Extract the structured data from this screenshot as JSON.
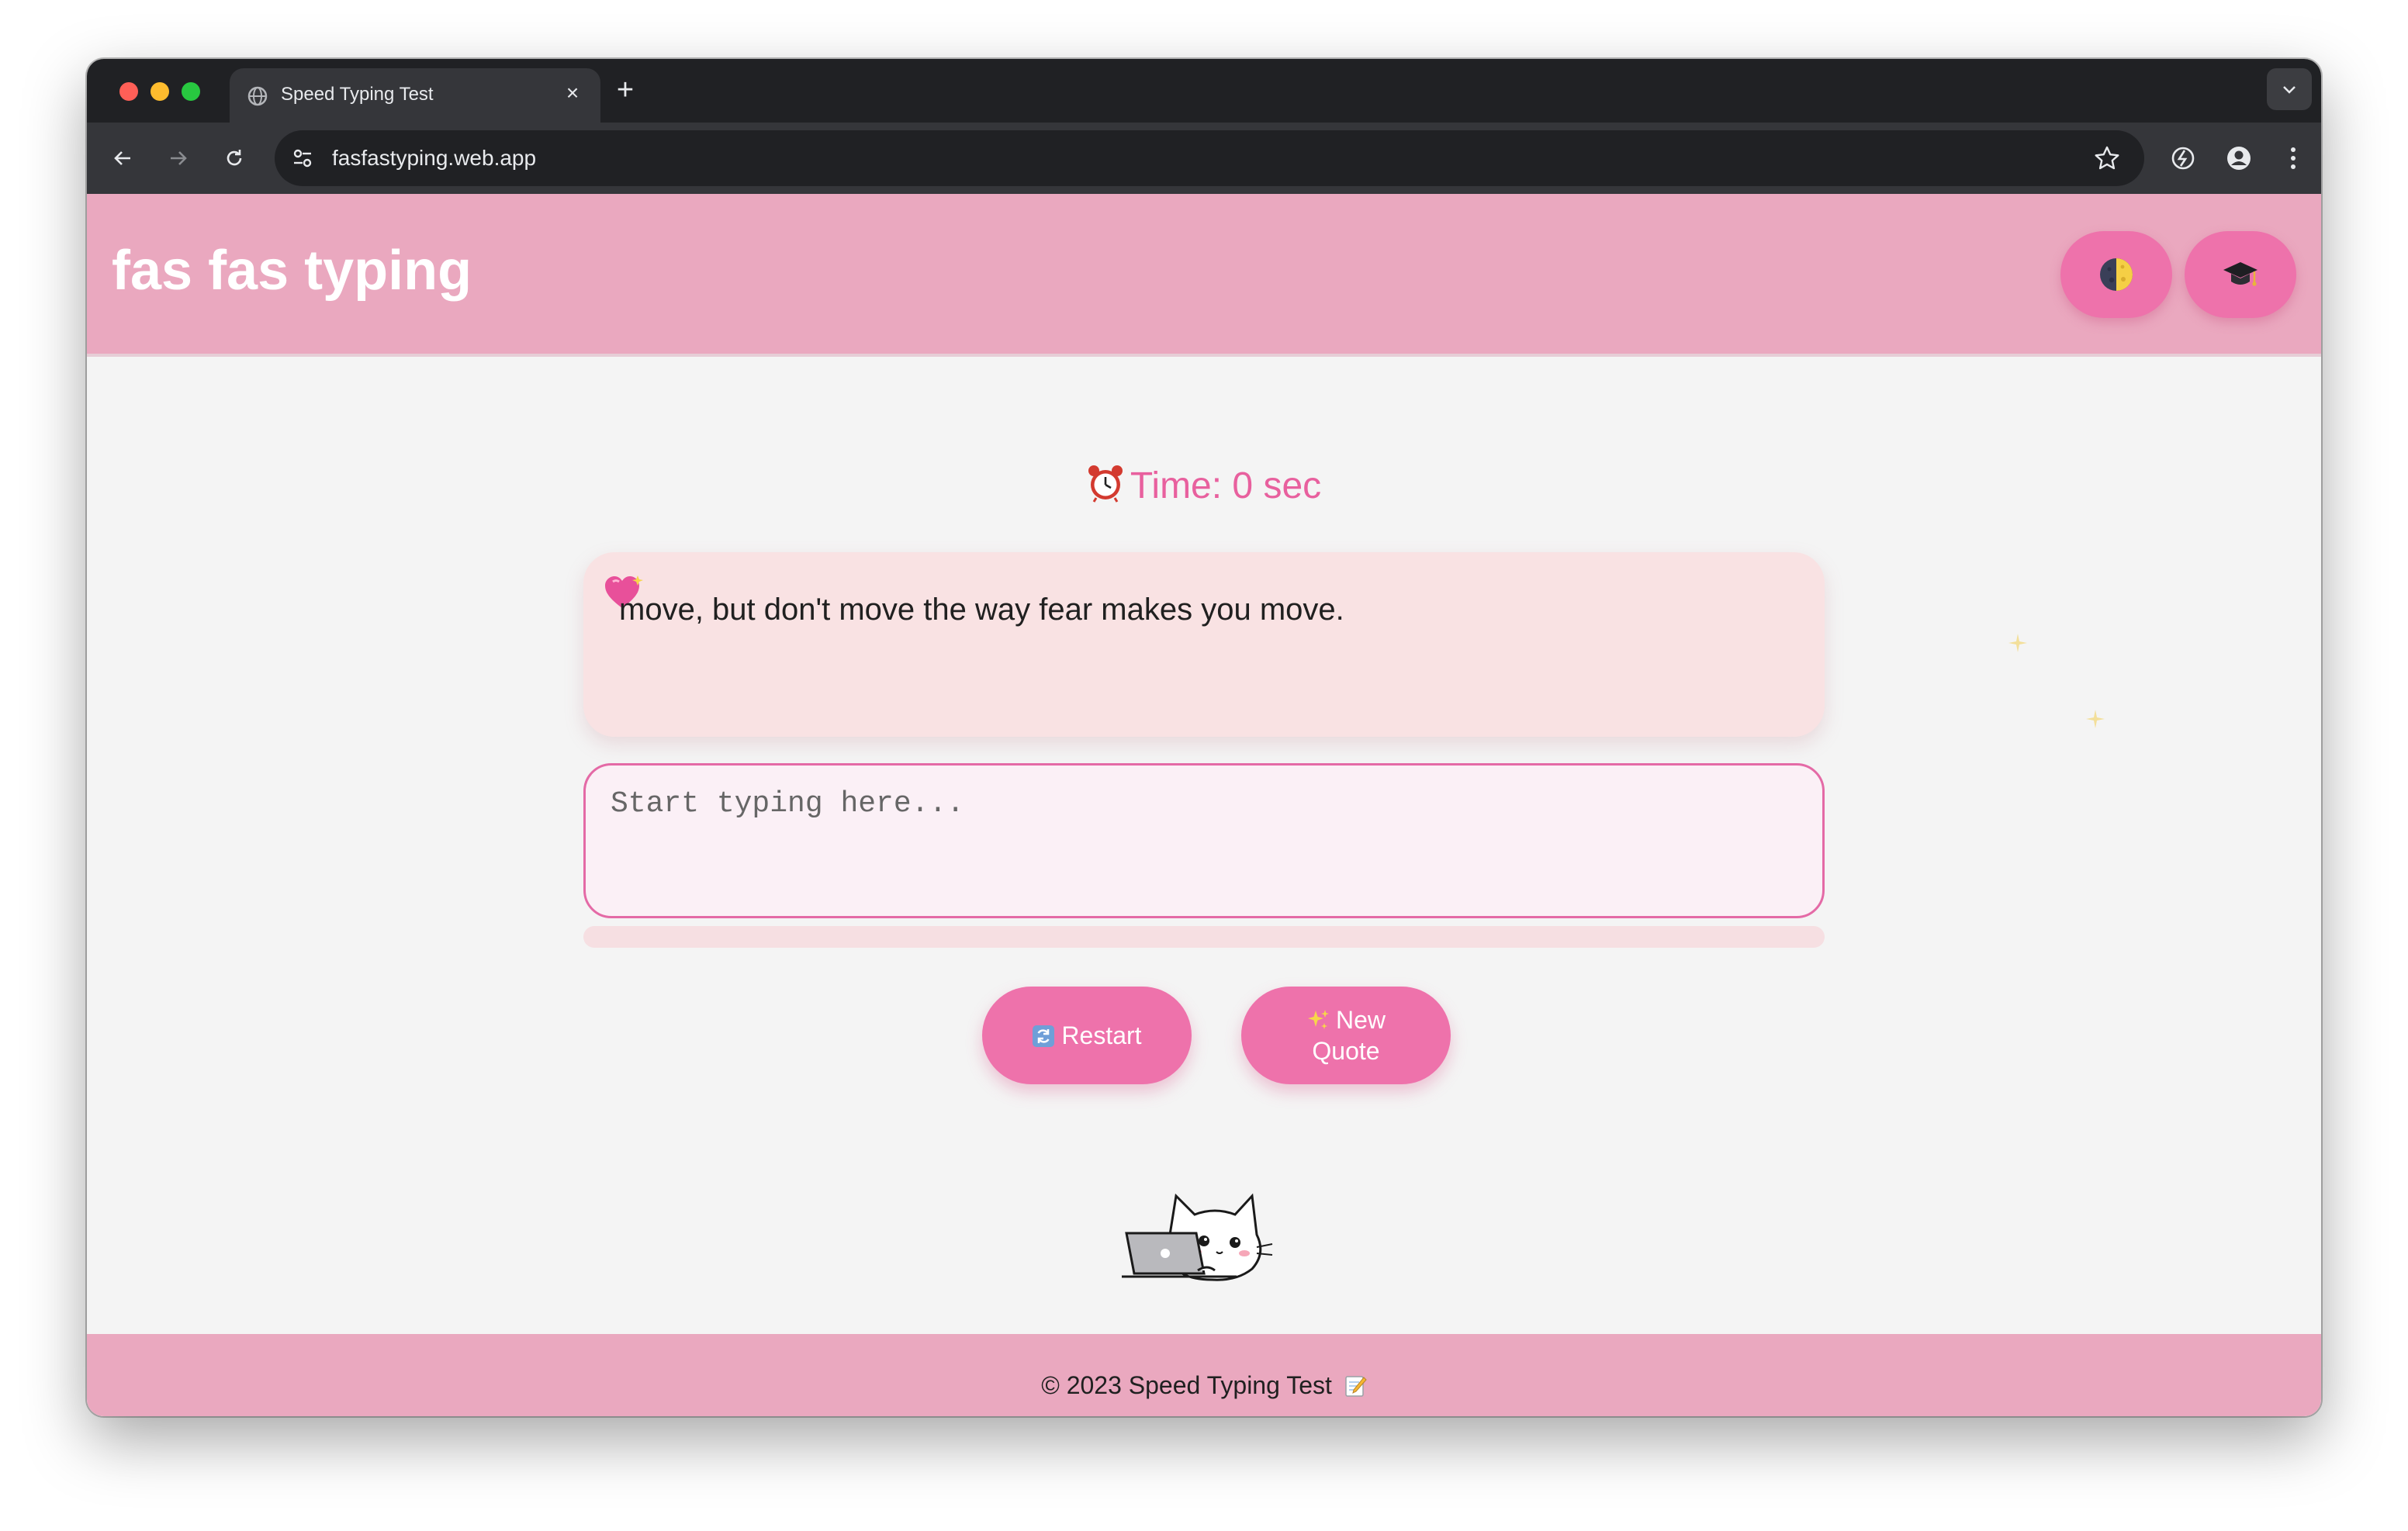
{
  "browser": {
    "tab_title": "Speed Typing Test",
    "url": "fasfastyping.web.app"
  },
  "header": {
    "site_title": "fas fas typing",
    "theme_toggle_icon": "moon-phase-icon",
    "learn_icon": "graduation-cap-icon"
  },
  "timer": {
    "label": "Time: 0 sec",
    "icon": "alarm-clock-icon"
  },
  "quote": {
    "text": "move, but don't move the way fear makes you move.",
    "icon": "sparkling-heart-icon"
  },
  "input": {
    "placeholder": "Start typing here...",
    "value": ""
  },
  "progress": {
    "percent": 0
  },
  "buttons": {
    "restart_label": "Restart",
    "restart_icon": "refresh-icon",
    "new_quote_line1": "New",
    "new_quote_line2": "Quote",
    "new_quote_icon": "sparkles-icon"
  },
  "footer": {
    "text": "© 2023 Speed Typing Test"
  },
  "colors": {
    "header_bg": "#eaa8bf",
    "accent": "#ee72ab",
    "timer_text": "#e8609e",
    "quote_bg": "#f9e2e3",
    "input_border": "#e46aa6",
    "page_bg": "#f4f4f4"
  }
}
